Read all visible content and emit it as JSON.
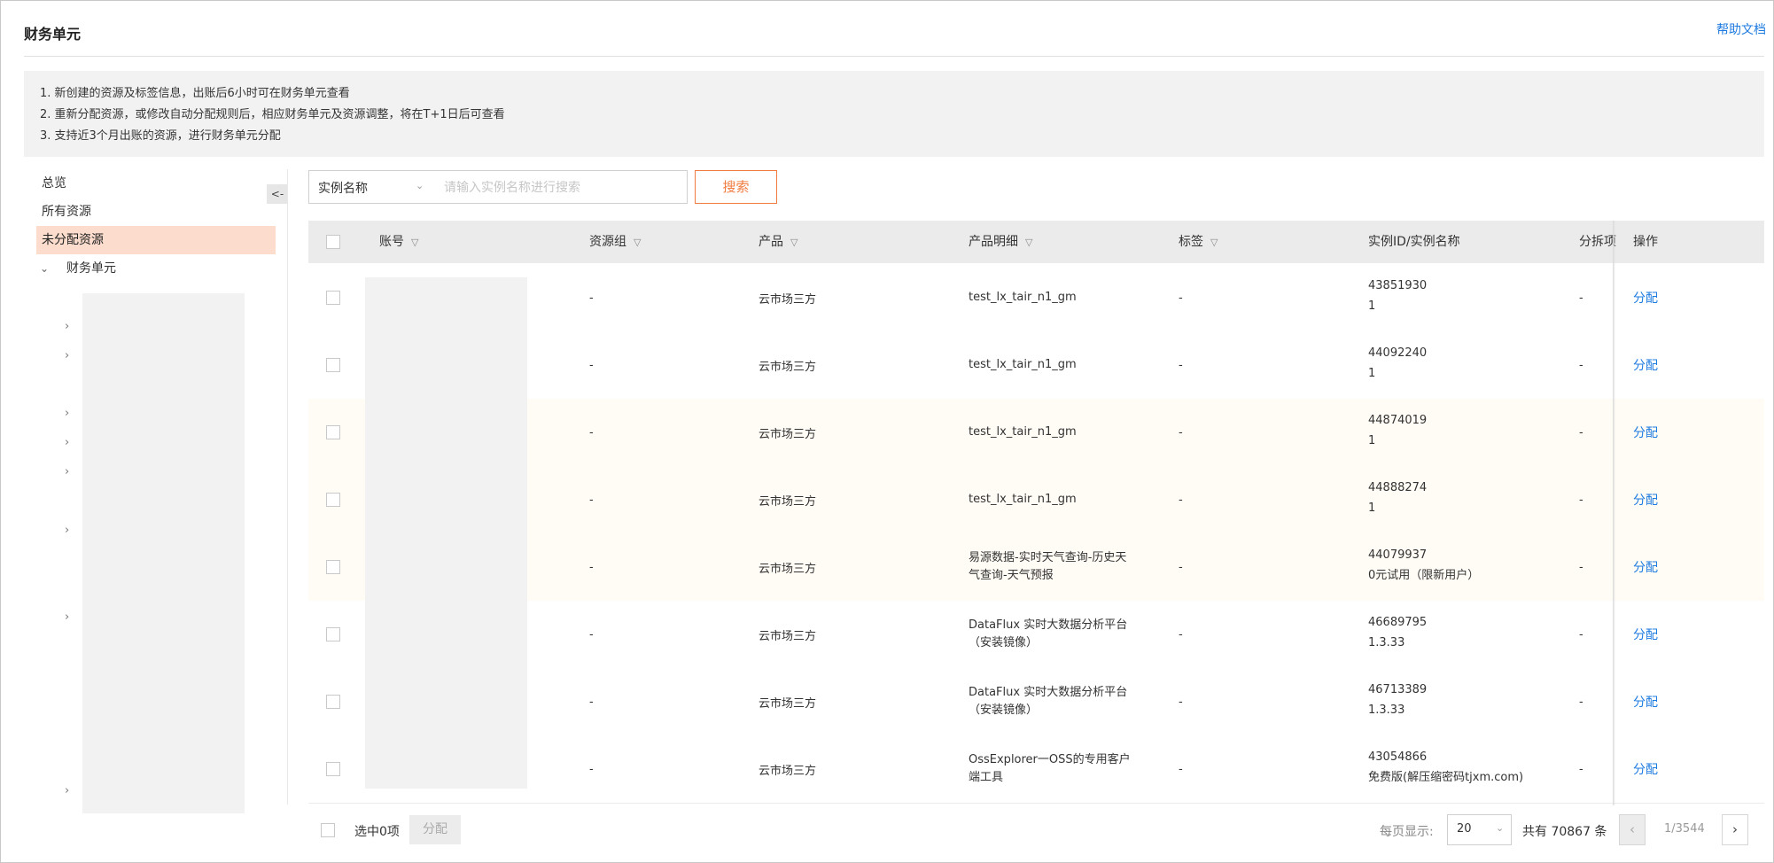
{
  "header": {
    "title": "财务单元",
    "help_link": "帮助文档"
  },
  "notice": [
    "1. 新创建的资源及标签信息，出账后6小时可在财务单元查看",
    "2. 重新分配资源，或修改自动分配规则后，相应财务单元及资源调整，将在T+1日后可查看",
    "3. 支持近3个月出账的资源，进行财务单元分配"
  ],
  "sidebar": {
    "items": [
      "总览",
      "所有资源",
      "未分配资源"
    ],
    "active": "未分配资源",
    "tree_root": "财务单元",
    "collapse_label": "<-"
  },
  "search": {
    "field": "实例名称",
    "placeholder": "请输入实例名称进行搜索",
    "button": "搜索"
  },
  "table": {
    "columns": [
      "账号",
      "资源组",
      "产品",
      "产品明细",
      "标签",
      "实例ID/实例名称",
      "分拆项",
      "操作"
    ],
    "rows": [
      {
        "resource_group": "-",
        "product": "云市场三方",
        "detail": "test_lx_tair_n1_gm",
        "tag": "-",
        "instance_id": "43851930",
        "instance_name": "1",
        "split": "-",
        "action": "分配"
      },
      {
        "resource_group": "-",
        "product": "云市场三方",
        "detail": "test_lx_tair_n1_gm",
        "tag": "-",
        "instance_id": "44092240",
        "instance_name": "1",
        "split": "-",
        "action": "分配"
      },
      {
        "resource_group": "-",
        "product": "云市场三方",
        "detail": "test_lx_tair_n1_gm",
        "tag": "-",
        "instance_id": "44874019",
        "instance_name": "1",
        "split": "-",
        "action": "分配"
      },
      {
        "resource_group": "-",
        "product": "云市场三方",
        "detail": "test_lx_tair_n1_gm",
        "tag": "-",
        "instance_id": "44888274",
        "instance_name": "1",
        "split": "-",
        "action": "分配"
      },
      {
        "resource_group": "-",
        "product": "云市场三方",
        "detail": "易源数据-实时天气查询-历史天\n气查询-天气预报",
        "tag": "-",
        "instance_id": "44079937",
        "instance_name": "0元试用（限新用户）",
        "split": "-",
        "action": "分配"
      },
      {
        "resource_group": "-",
        "product": "云市场三方",
        "detail": "DataFlux 实时大数据分析平台\n（安装镜像）",
        "tag": "-",
        "instance_id": "46689795",
        "instance_name": "1.3.33",
        "split": "-",
        "action": "分配"
      },
      {
        "resource_group": "-",
        "product": "云市场三方",
        "detail": "DataFlux 实时大数据分析平台\n（安装镜像）",
        "tag": "-",
        "instance_id": "46713389",
        "instance_name": "1.3.33",
        "split": "-",
        "action": "分配"
      },
      {
        "resource_group": "-",
        "product": "云市场三方",
        "detail": "OssExplorer一OSS的专用客户\n端工具",
        "tag": "-",
        "instance_id": "43054866",
        "instance_name": "免费版(解压缩密码tjxm.com)",
        "split": "-",
        "action": "分配"
      }
    ]
  },
  "footer": {
    "selected_label": "选中0项",
    "assign_button": "分配",
    "per_page_label": "每页显示:",
    "per_page": "20",
    "total": "共有 70867 条",
    "page_info": "1/3544",
    "prev": "‹",
    "next": "›"
  },
  "colors": {
    "accent": "#f07b3f",
    "link": "#1e7be0",
    "active_bg": "#fcdccc"
  }
}
